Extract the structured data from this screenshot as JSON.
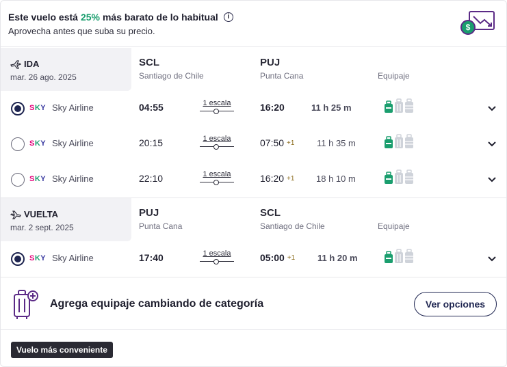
{
  "banner": {
    "text_before": "Este vuelo está",
    "percent": "25%",
    "text_after": "más barato de lo habitual",
    "subtitle": "Aprovecha antes que suba su precio."
  },
  "outbound": {
    "label": "IDA",
    "date": "mar. 26 ago. 2025",
    "origin_code": "SCL",
    "origin_city": "Santiago de Chile",
    "dest_code": "PUJ",
    "dest_city": "Punta Cana",
    "equipment_label": "Equipaje",
    "flights": [
      {
        "selected": true,
        "logo": "SKY",
        "airline": "Sky Airline",
        "depart": "04:55",
        "stops": "1 escala",
        "arrive": "16:20",
        "plus": "",
        "duration": "11 h 25 m"
      },
      {
        "selected": false,
        "logo": "SKY",
        "airline": "Sky Airline",
        "depart": "20:15",
        "stops": "1 escala",
        "arrive": "07:50",
        "plus": "+1",
        "duration": "11 h 35 m"
      },
      {
        "selected": false,
        "logo": "SKY",
        "airline": "Sky Airline",
        "depart": "22:10",
        "stops": "1 escala",
        "arrive": "16:20",
        "plus": "+1",
        "duration": "18 h 10 m"
      }
    ]
  },
  "return": {
    "label": "VUELTA",
    "date": "mar. 2 sept. 2025",
    "origin_code": "PUJ",
    "origin_city": "Punta Cana",
    "dest_code": "SCL",
    "dest_city": "Santiago de Chile",
    "equipment_label": "Equipaje",
    "flights": [
      {
        "selected": true,
        "logo": "SKY",
        "airline": "Sky Airline",
        "depart": "17:40",
        "stops": "1 escala",
        "arrive": "05:00",
        "plus": "+1",
        "duration": "11 h 20 m"
      }
    ]
  },
  "upsell": {
    "text": "Agrega equipaje cambiando de categoría",
    "button": "Ver opciones"
  },
  "tag": "Vuelo más conveniente",
  "icons": {
    "info": "info-icon",
    "price_drop": "price-drop-icon",
    "plane_out": "plane-departure-icon",
    "plane_back": "plane-return-icon",
    "bags": "baggage-icons",
    "chevron": "chevron-down-icon",
    "luggage_plus": "luggage-plus-icon"
  },
  "colors": {
    "accent_green": "#1a9e6e",
    "navy": "#1e2550",
    "purple": "#5b2a86"
  }
}
